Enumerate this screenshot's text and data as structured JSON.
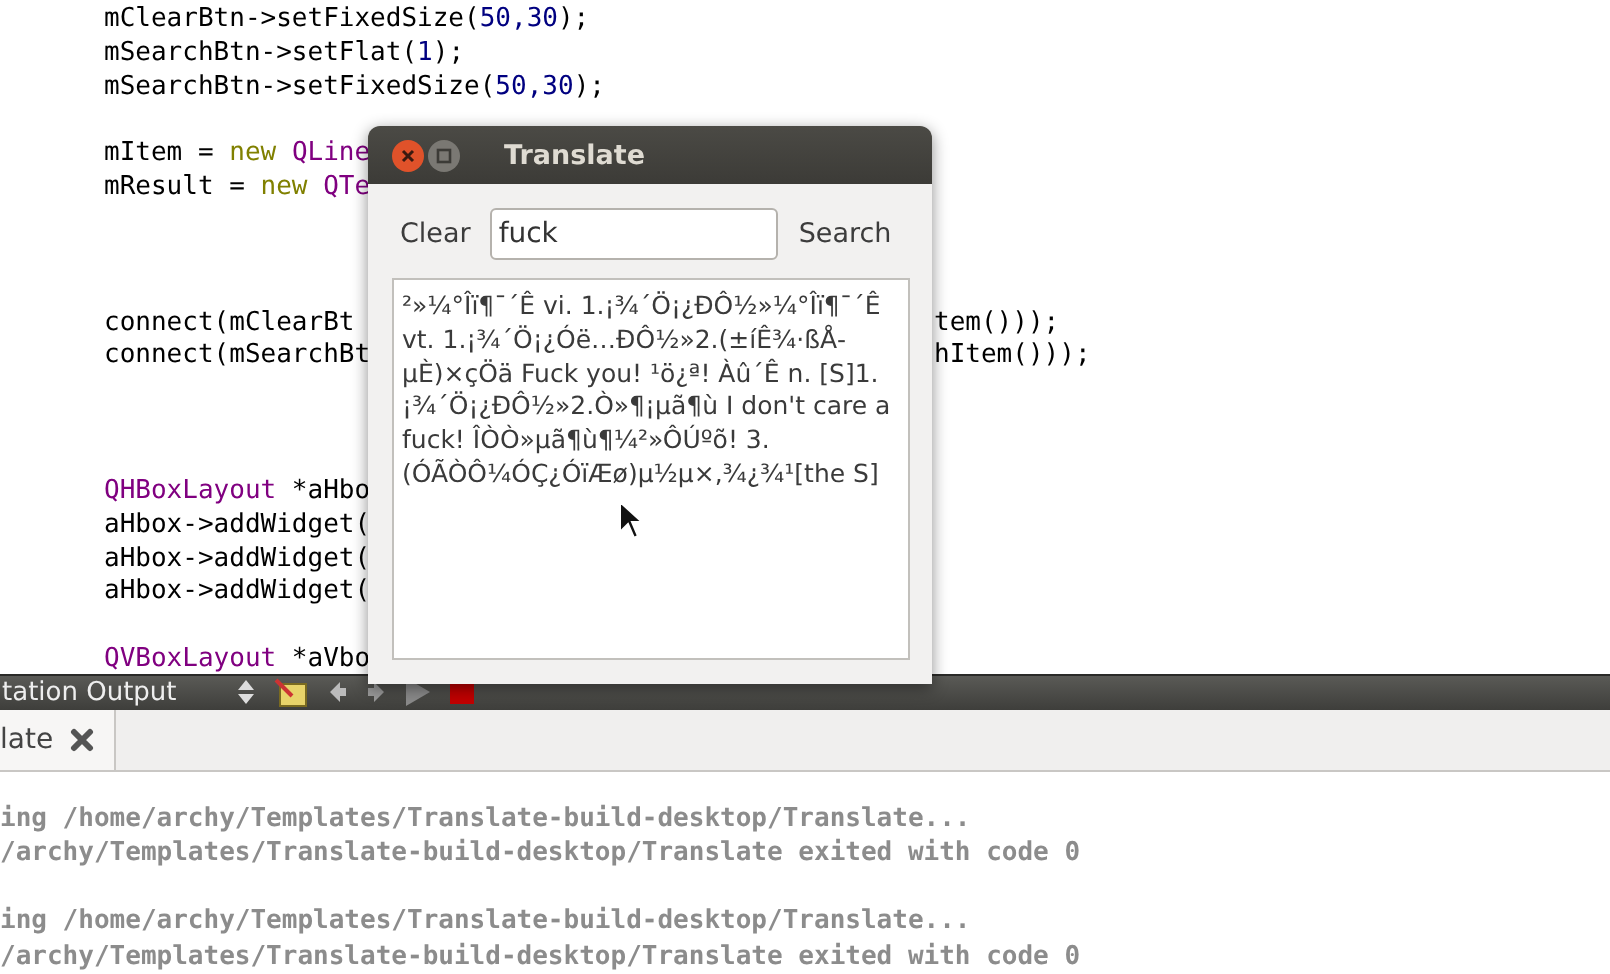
{
  "editor": {
    "lines": [
      {
        "kind": "code",
        "tokens": [
          {
            "kind": "plain",
            "text": "mClearBtn->setFixedSize("
          },
          {
            "kind": "number",
            "text": "50,30"
          },
          {
            "kind": "plain",
            "text": ");"
          }
        ]
      },
      {
        "kind": "code",
        "tokens": [
          {
            "kind": "plain",
            "text": "mSearchBtn->setFlat("
          },
          {
            "kind": "number",
            "text": "1"
          },
          {
            "kind": "plain",
            "text": ");"
          }
        ]
      },
      {
        "kind": "code",
        "tokens": [
          {
            "kind": "plain",
            "text": "mSearchBtn->setFixedSize("
          },
          {
            "kind": "number",
            "text": "50,30"
          },
          {
            "kind": "plain",
            "text": ");"
          }
        ]
      },
      {
        "kind": "blank"
      },
      {
        "kind": "code",
        "tokens": [
          {
            "kind": "plain",
            "text": "mItem = "
          },
          {
            "kind": "keyword",
            "text": "new "
          },
          {
            "kind": "type",
            "text": "QLine"
          }
        ]
      },
      {
        "kind": "code",
        "tokens": [
          {
            "kind": "plain",
            "text": "mResult = "
          },
          {
            "kind": "keyword",
            "text": "new "
          },
          {
            "kind": "type",
            "text": "QTe"
          }
        ]
      },
      {
        "kind": "blank"
      },
      {
        "kind": "blank"
      },
      {
        "kind": "blank"
      },
      {
        "kind": "code",
        "tokens": [
          {
            "kind": "plain",
            "text": "connect(mClearBt"
          }
        ],
        "tail": "tem()));"
      },
      {
        "kind": "code",
        "tokens": [
          {
            "kind": "plain",
            "text": "connect(mSearchBt"
          }
        ],
        "tail": "hItem()));"
      },
      {
        "kind": "blank"
      },
      {
        "kind": "blank"
      },
      {
        "kind": "blank"
      },
      {
        "kind": "code",
        "tokens": [
          {
            "kind": "type",
            "text": "QHBoxLayout"
          },
          {
            "kind": "plain",
            "text": " *aHbo"
          }
        ]
      },
      {
        "kind": "code",
        "tokens": [
          {
            "kind": "plain",
            "text": "aHbox->addWidget("
          }
        ]
      },
      {
        "kind": "code",
        "tokens": [
          {
            "kind": "plain",
            "text": "aHbox->addWidget("
          }
        ]
      },
      {
        "kind": "code",
        "tokens": [
          {
            "kind": "plain",
            "text": "aHbox->addWidget("
          }
        ]
      },
      {
        "kind": "blank"
      },
      {
        "kind": "code",
        "tokens": [
          {
            "kind": "type",
            "text": "QVBoxLayout"
          },
          {
            "kind": "plain",
            "text": " *aVbo"
          }
        ]
      }
    ]
  },
  "output_pane": {
    "title": "tation Output",
    "tabs": [
      {
        "label": "late",
        "selected": true
      }
    ],
    "lines": [
      {
        "kind": "text",
        "text": "ing /home/archy/Templates/Translate-build-desktop/Translate..."
      },
      {
        "kind": "text",
        "text": "/archy/Templates/Translate-build-desktop/Translate exited with code 0"
      },
      {
        "kind": "blank"
      },
      {
        "kind": "text",
        "text": "ing /home/archy/Templates/Translate-build-desktop/Translate..."
      },
      {
        "kind": "text",
        "text": "/archy/Templates/Translate-build-desktop/Translate exited with code 0"
      }
    ]
  },
  "dialog": {
    "title": "Translate",
    "clear_button": "Clear",
    "search_field": {
      "value": "fuck"
    },
    "search_button": "Search",
    "result": "²»¼°Îï¶¯´Ê vi. 1.¡¾´Ö¡¿ÐÔ½»¼°Îï¶¯´Ê vt. 1.¡¾´Ö¡¿Óë…ÐÔ½»2.(±íÊ¾·ßÅ-µÈ)×çÖä Fuck you!  ¹ö¿ª! Àû´Ê n. [S]1.¡¾´Ö¡¿ÐÔ½»2.Ò»¶¡µã¶ù I don't care a fuck!  ÎÒÒ»µã¶ù¶¼²»ÔÚºõ! 3.(ÓÃÒÔ¼ÓÇ¿ÓïÆø)µ½µ×,¾¿¾¹[the S]"
  }
}
